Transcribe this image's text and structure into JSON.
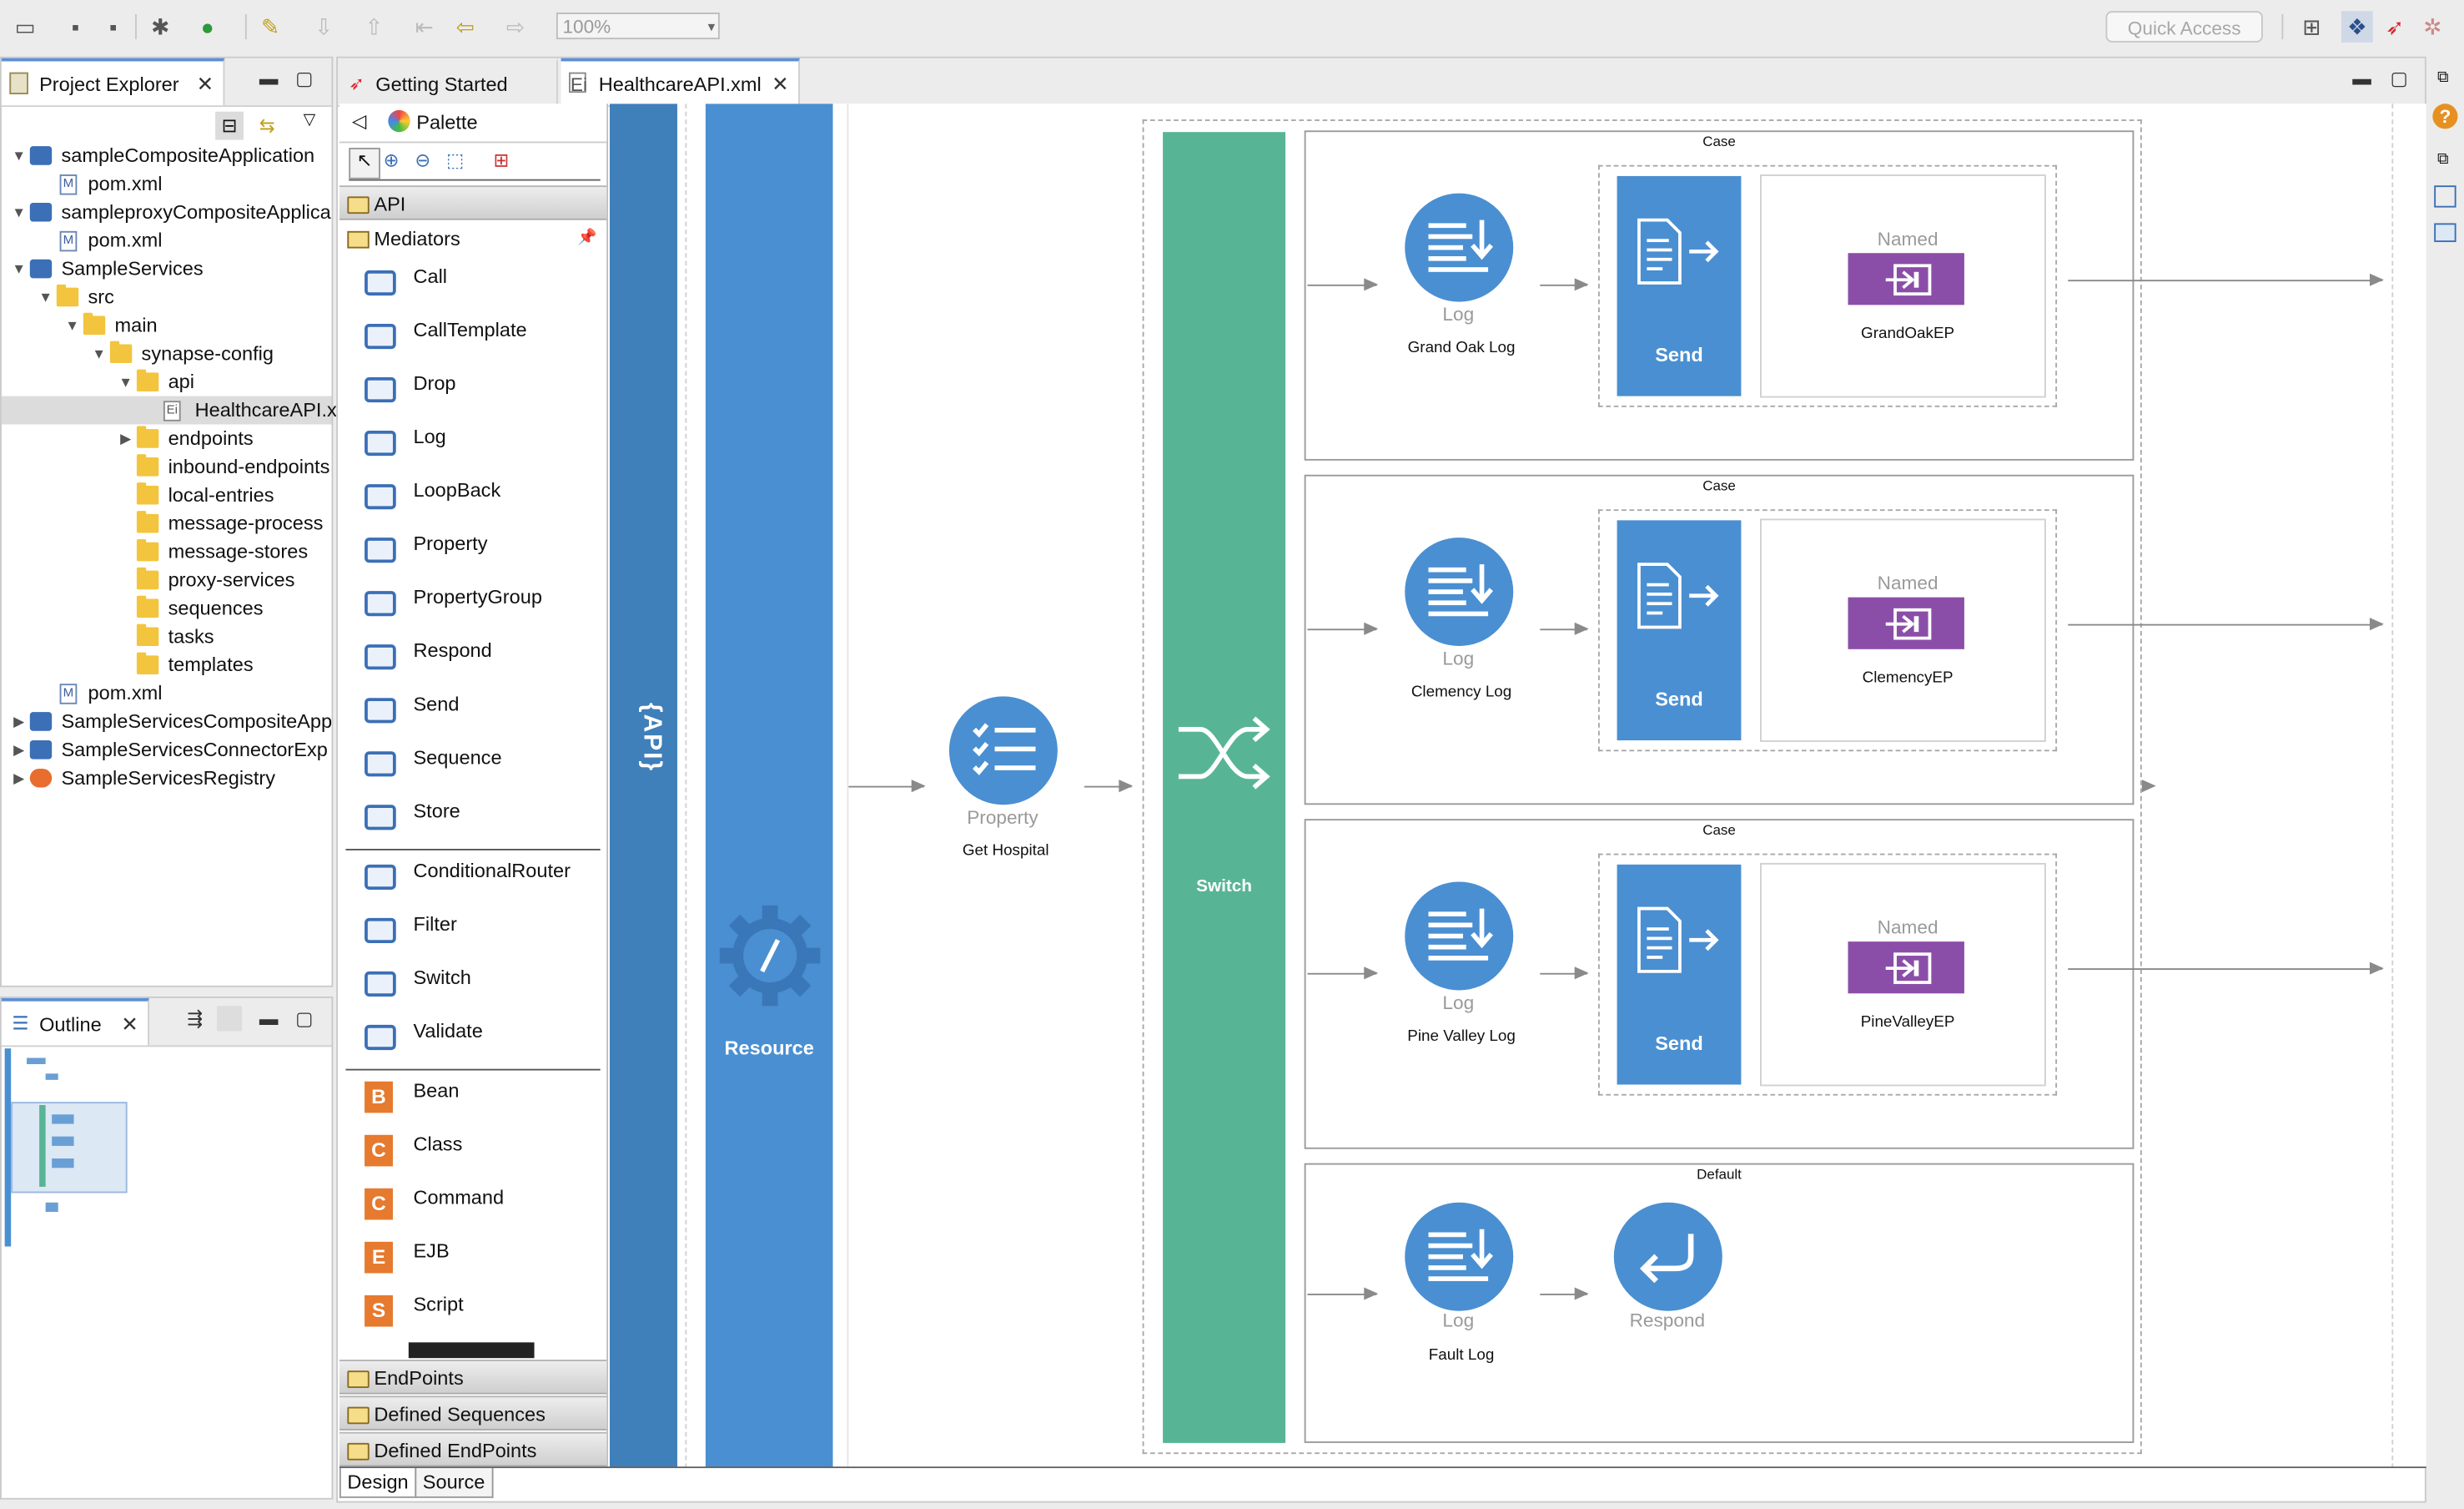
{
  "toolbar": {
    "zoom": "100%",
    "quick_access": "Quick Access"
  },
  "project_explorer": {
    "title": "Project Explorer",
    "items": [
      {
        "label": "sampleCompositeApplication",
        "indent": 0,
        "twisty": "open",
        "icon": "composite"
      },
      {
        "label": "pom.xml",
        "indent": 1,
        "twisty": "",
        "icon": "maven"
      },
      {
        "label": "sampleproxyCompositeApplica",
        "indent": 0,
        "twisty": "open",
        "icon": "composite"
      },
      {
        "label": "pom.xml",
        "indent": 1,
        "twisty": "",
        "icon": "maven"
      },
      {
        "label": "SampleServices",
        "indent": 0,
        "twisty": "open",
        "icon": "project"
      },
      {
        "label": "src",
        "indent": 1,
        "twisty": "open",
        "icon": "folder"
      },
      {
        "label": "main",
        "indent": 2,
        "twisty": "open",
        "icon": "folder"
      },
      {
        "label": "synapse-config",
        "indent": 3,
        "twisty": "open",
        "icon": "folder"
      },
      {
        "label": "api",
        "indent": 4,
        "twisty": "open",
        "icon": "folder"
      },
      {
        "label": "HealthcareAPI.x",
        "indent": 5,
        "twisty": "",
        "icon": "file",
        "selected": true
      },
      {
        "label": "endpoints",
        "indent": 4,
        "twisty": "closed",
        "icon": "folder"
      },
      {
        "label": "inbound-endpoints",
        "indent": 4,
        "twisty": "",
        "icon": "folder"
      },
      {
        "label": "local-entries",
        "indent": 4,
        "twisty": "",
        "icon": "folder"
      },
      {
        "label": "message-process",
        "indent": 4,
        "twisty": "",
        "icon": "folder"
      },
      {
        "label": "message-stores",
        "indent": 4,
        "twisty": "",
        "icon": "folder"
      },
      {
        "label": "proxy-services",
        "indent": 4,
        "twisty": "",
        "icon": "folder"
      },
      {
        "label": "sequences",
        "indent": 4,
        "twisty": "",
        "icon": "folder"
      },
      {
        "label": "tasks",
        "indent": 4,
        "twisty": "",
        "icon": "folder"
      },
      {
        "label": "templates",
        "indent": 4,
        "twisty": "",
        "icon": "folder"
      },
      {
        "label": "pom.xml",
        "indent": 1,
        "twisty": "",
        "icon": "maven"
      },
      {
        "label": "SampleServicesCompositeApp",
        "indent": 0,
        "twisty": "closed",
        "icon": "composite"
      },
      {
        "label": "SampleServicesConnectorExp",
        "indent": 0,
        "twisty": "closed",
        "icon": "composite"
      },
      {
        "label": "SampleServicesRegistry",
        "indent": 0,
        "twisty": "closed",
        "icon": "registry"
      }
    ]
  },
  "outline": {
    "title": "Outline"
  },
  "editor_tabs": [
    {
      "label": "Getting Started",
      "active": false
    },
    {
      "label": "HealthcareAPI.xml",
      "active": true
    }
  ],
  "palette": {
    "title": "Palette",
    "drawers": {
      "api": "API",
      "mediators": "Mediators",
      "endpoints": "EndPoints",
      "defined_sequences": "Defined Sequences",
      "defined_endpoints": "Defined EndPoints"
    },
    "group1": [
      "Call",
      "CallTemplate",
      "Drop",
      "Log",
      "LoopBack",
      "Property",
      "PropertyGroup",
      "Respond",
      "Send",
      "Sequence",
      "Store"
    ],
    "group2": [
      "ConditionalRouter",
      "Filter",
      "Switch",
      "Validate"
    ],
    "group3": [
      "Bean",
      "Class",
      "Command",
      "EJB",
      "Script"
    ]
  },
  "canvas": {
    "api_label": "API",
    "resource_label": "Resource",
    "property": {
      "type": "Property",
      "name": "Get Hospital"
    },
    "switch_label": "Switch",
    "cases": [
      {
        "title": "Case",
        "log_type": "Log",
        "log_name": "Grand Oak Log",
        "send": "Send",
        "named": "Named",
        "endpoint": "GrandOakEP"
      },
      {
        "title": "Case",
        "log_type": "Log",
        "log_name": "Clemency Log",
        "send": "Send",
        "named": "Named",
        "endpoint": "ClemencyEP"
      },
      {
        "title": "Case",
        "log_type": "Log",
        "log_name": "Pine Valley Log",
        "send": "Send",
        "named": "Named",
        "endpoint": "PineValleyEP"
      }
    ],
    "default": {
      "title": "Default",
      "log_type": "Log",
      "log_name": "Fault Log",
      "respond": "Respond"
    }
  },
  "bottom_tabs": {
    "design": "Design",
    "source": "Source"
  },
  "colors": {
    "blue": "#4a8fd1",
    "switch_green": "#57b596",
    "endpoint_purple": "#8b4ea8",
    "api_bar": "#3f7fba"
  }
}
